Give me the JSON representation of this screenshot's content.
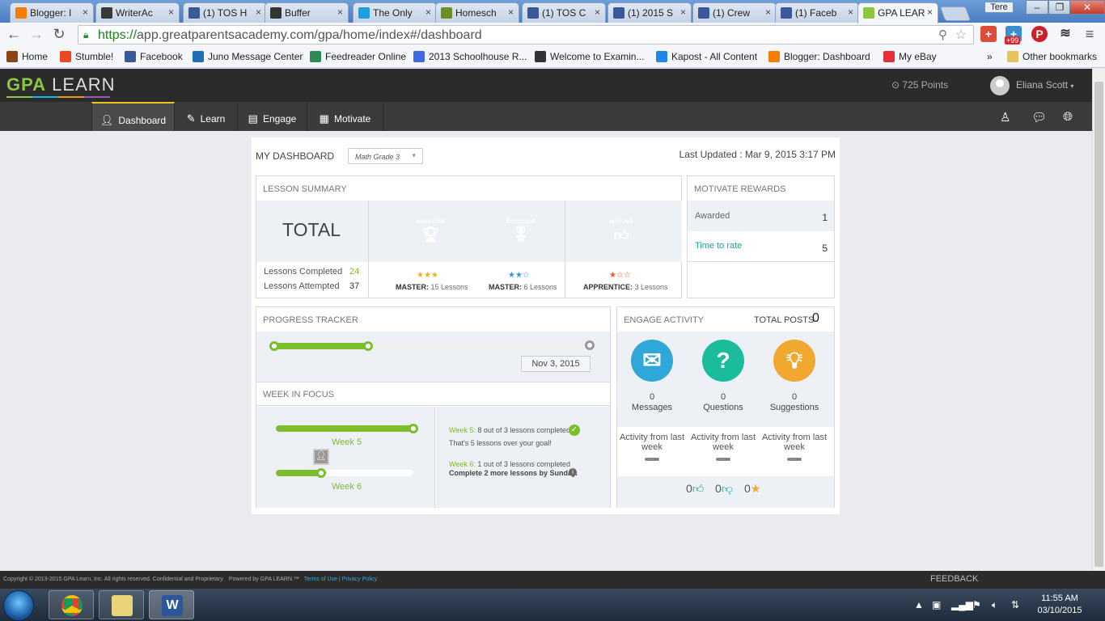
{
  "browser": {
    "tabs": [
      {
        "label": "Blogger: I",
        "icon": "blogger-icon",
        "color": "#f57d00"
      },
      {
        "label": "WriterAc",
        "icon": "writeraccess-icon",
        "color": "#3a3a3a"
      },
      {
        "label": "(1) TOS H",
        "icon": "facebook-icon",
        "color": "#3b5998"
      },
      {
        "label": "Buffer",
        "icon": "buffer-icon",
        "color": "#333333"
      },
      {
        "label": "The Only",
        "icon": "drop-icon",
        "color": "#1ba1e2"
      },
      {
        "label": "Homesch",
        "icon": "homeschool-icon",
        "color": "#6b8e23"
      },
      {
        "label": "(1) TOS C",
        "icon": "facebook-icon",
        "color": "#3b5998"
      },
      {
        "label": "(1) 2015 S",
        "icon": "facebook-icon",
        "color": "#3b5998"
      },
      {
        "label": "(1) Crew",
        "icon": "facebook-icon",
        "color": "#3b5998"
      },
      {
        "label": "(1) Faceb",
        "icon": "facebook-icon",
        "color": "#3b5998"
      },
      {
        "label": "GPA LEAR",
        "icon": "gpa-icon",
        "color": "#8dc63f"
      }
    ],
    "user_button": "Tere",
    "url_secure": "https://",
    "url_rest": "app.greatparentsacademy.com/gpa/home/index#/dashboard",
    "ext_badge": "+99",
    "bookmarks": [
      {
        "label": "Home",
        "icon": "home-icon",
        "color": "#8b4513"
      },
      {
        "label": "Stumble!",
        "icon": "stumbleupon-icon",
        "color": "#eb4924"
      },
      {
        "label": "Facebook",
        "icon": "facebook-icon",
        "color": "#3b5998"
      },
      {
        "label": "Juno Message Center",
        "icon": "juno-icon",
        "color": "#1e6fb8"
      },
      {
        "label": "Feedreader Online",
        "icon": "feedreader-icon",
        "color": "#2e8b57"
      },
      {
        "label": "2013 Schoolhouse R...",
        "icon": "schoolhouse-icon",
        "color": "#4169e1"
      },
      {
        "label": "Welcome to Examin...",
        "icon": "examiner-icon",
        "color": "#333333"
      },
      {
        "label": "Kapost - All Content",
        "icon": "kapost-icon",
        "color": "#1e88e5"
      },
      {
        "label": "Blogger: Dashboard",
        "icon": "blogger-icon",
        "color": "#f57d00"
      },
      {
        "label": "My eBay",
        "icon": "ebay-icon",
        "color": "#e53238"
      }
    ],
    "more": "»",
    "other_bookmarks": "Other bookmarks"
  },
  "app": {
    "logo_a": "GPA",
    "logo_b": "LEARN",
    "points": "725 Points",
    "user": "Eliana Scott",
    "nav": [
      {
        "label": "Dashboard",
        "icon": "person-icon"
      },
      {
        "label": "Learn",
        "icon": "pencil-icon"
      },
      {
        "label": "Engage",
        "icon": "chat-icon"
      },
      {
        "label": "Motivate",
        "icon": "grid-icon"
      }
    ]
  },
  "dashboard": {
    "title": "MY DASHBOARD",
    "grade_select": "Math Grade 3",
    "last_updated": "Last Updated : Mar 9, 2015 3:17 PM",
    "lesson_summary": {
      "header": "LESSON SUMMARY",
      "total": "TOTAL",
      "completed_label": "Lessons Completed",
      "completed": "24",
      "attempted_label": "Lessons Attempted",
      "attempted": "37",
      "badges": [
        {
          "name": "ROCKSTAR",
          "color": "#f2ae1c",
          "stars": "★★★",
          "star_color": "#f2ae1c",
          "level": "MASTER:",
          "lessons": "15 Lessons"
        },
        {
          "name": "EXCELLENT",
          "color": "#3498db",
          "stars": "★★☆",
          "star_color": "#3498db",
          "level": "MASTER:",
          "lessons": "6 Lessons"
        },
        {
          "name": "NICE JOB",
          "color": "#f05a1a",
          "stars": "★☆☆",
          "star_color": "#f05a1a",
          "level": "APPRENTICE:",
          "lessons": "3 Lessons"
        }
      ]
    },
    "motivate_rewards": {
      "header": "MOTIVATE REWARDS",
      "awarded_label": "Awarded",
      "awarded": "1",
      "rate_label": "Time to rate",
      "rate": "5"
    },
    "progress_tracker": {
      "header": "PROGRESS TRACKER",
      "progress": 0.3,
      "date": "Nov 3, 2015"
    },
    "week_in_focus": {
      "header": "WEEK IN FOCUS",
      "week5_label": "Week 5",
      "week5_progress": 1.0,
      "week6_label": "Week 6",
      "week6_progress": 0.33,
      "w5_title": "Week 5:",
      "w5_text": "8 out of 3 lessons completed",
      "w5_sub": "That's 5 lessons over your goal!",
      "w6_title": "Week 6:",
      "w6_text": "1 out of 3 lessons completed",
      "w6_sub": "Complete 2 more lessons by Sunday."
    },
    "engage_activity": {
      "header": "ENGAGE ACTIVITY",
      "total_label": "TOTAL POSTS",
      "total": "0",
      "items": [
        {
          "label": "Messages",
          "count": "0",
          "color": "#2fa8d9",
          "icon": "envelope-icon"
        },
        {
          "label": "Questions",
          "count": "0",
          "color": "#1abc9c",
          "icon": "question-icon"
        },
        {
          "label": "Suggestions",
          "count": "0",
          "color": "#f0a830",
          "icon": "lightbulb-icon"
        }
      ],
      "activity_label": "Activity from last week",
      "likes": "0",
      "dislikes": "0",
      "stars": "0"
    }
  },
  "footer": {
    "copyright": "Copyright © 2013-2015 GPA Learn, Inc. All rights reserved. Confidential and Proprietary.",
    "powered": "Powered by GPA LEARN.™",
    "terms": "Terms of Use",
    "sep": "|",
    "privacy": "Privacy Policy",
    "feedback": "FEEDBACK"
  },
  "taskbar": {
    "time": "11:55 AM",
    "date": "03/10/2015"
  }
}
